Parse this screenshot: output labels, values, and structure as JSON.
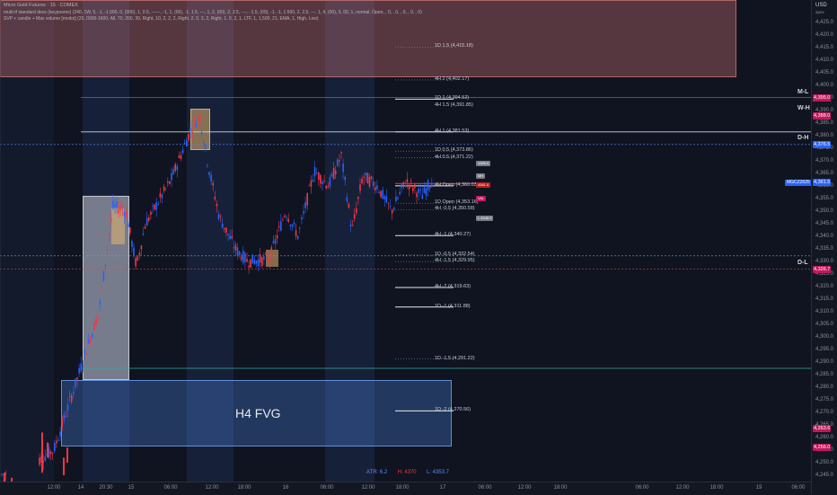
{
  "header": {
    "title": "Micro Gold Futures · 15 · COMEX",
    "indicator1": "multi-tf standard devs (keypoems) (240, 1W, 0, -1, -1.500, 0, (005), 1, 0.5, ------, -1, 1, (00), -1, 1.5, ---, 1, 2, (00), 2, 2.5, ----, -1.5, (00), -1, -1, 1.500, 2, 2.5, ---, 1, 4, (00), 3, 00, 1, normal, Open, , 0, , 0, , 0, , 0, , 0)",
    "indicator2": "SVP + candle + Max volume [mvdot] (20, 0930-1600, All, 70, 200, 30, Right, 10, 2, 2, 2, Right, 2, 0, 3, 2, Right, 1, 0, 2, 1, LTF, 1, 1,500, 21, EMA, 1, High, Low)"
  },
  "currency": "USD",
  "currency_sub": "apex",
  "price_ticks": [
    "4,425.0",
    "4,420.0",
    "4,415.0",
    "4,410.0",
    "4,405.0",
    "4,400.0",
    "4,395.0",
    "4,390.0",
    "4,385.0",
    "4,380.0",
    "4,375.0",
    "4,370.0",
    "4,365.0",
    "4,360.0",
    "4,355.0",
    "4,350.0",
    "4,345.0",
    "4,340.0",
    "4,335.0",
    "4,330.0",
    "4,325.0",
    "4,320.0",
    "4,315.0",
    "4,310.0",
    "4,305.0",
    "4,300.0",
    "4,295.0",
    "4,290.0",
    "4,285.0",
    "4,280.0",
    "4,275.0",
    "4,270.0",
    "4,265.0",
    "4,260.0",
    "4,255.0",
    "4,250.0",
    "4,245.0"
  ],
  "time_ticks": [
    "12:00",
    "14",
    "20:30",
    "15",
    "06:00",
    "12:00",
    "18:00",
    "16",
    "06:00",
    "12:00",
    "18:00",
    "17",
    "06:00",
    "12:00",
    "18:00",
    "06:00",
    "12:00",
    "18:00",
    "19",
    "06:00"
  ],
  "price_tags": [
    {
      "text": "4,395.0",
      "price": 4395.0,
      "color": "#c2185b"
    },
    {
      "text": "4,388.0",
      "price": 4388.0,
      "color": "#c2185b"
    },
    {
      "text": "4,376.5",
      "price": 4376.5,
      "color": "#2962ff"
    },
    {
      "text": "4,361.5",
      "price": 4361.5,
      "color": "#2962ff"
    },
    {
      "text": "4,326.7",
      "price": 4326.7,
      "color": "#c2185b"
    },
    {
      "text": "4,263.6",
      "price": 4263.6,
      "color": "#c2185b"
    },
    {
      "text": "4,256.0",
      "price": 4256.0,
      "color": "#c2185b"
    }
  ],
  "symbol_tag": "MGCZ2025",
  "side_labels": [
    {
      "text": "M-L",
      "price": 4395.5
    },
    {
      "text": "W-H",
      "price": 4389.0
    },
    {
      "text": "D-H",
      "price": 4377.3
    },
    {
      "text": "D-L",
      "price": 4327.5
    }
  ],
  "levels": [
    {
      "label": "1D 1.5 (4,415.18)",
      "price": 4415.18,
      "style": "dotted"
    },
    {
      "label": "4H 2 (4,402.17)",
      "price": 4402.17,
      "style": "dotted"
    },
    {
      "label": "1D 1 (4,394.52)",
      "price": 4394.52,
      "style": "solid"
    },
    {
      "label": "4H 1.5 (4,391.85)",
      "price": 4391.85,
      "style": "none"
    },
    {
      "label": "4H 1 (4,381.53)",
      "price": 4381.53,
      "style": "solid"
    },
    {
      "label": "1D 0.5 (4,373.86)",
      "price": 4373.86,
      "style": "dotted"
    },
    {
      "label": "4H 0.5 (4,371.22)",
      "price": 4371.22,
      "style": "dotted"
    },
    {
      "label": "4H Open (4,360.03)",
      "price": 4360.03,
      "style": "solid"
    },
    {
      "label": "1D Open (4,353.16)",
      "price": 4353.16,
      "style": "dotted"
    },
    {
      "label": "4H -0.5 (4,350.58)",
      "price": 4350.58,
      "style": "dotted"
    },
    {
      "label": "4H -1 (4,340.27)",
      "price": 4340.27,
      "style": "solid"
    },
    {
      "label": "1D -0.5 (4,332.54)",
      "price": 4332.54,
      "style": "dotted"
    },
    {
      "label": "4H -1.5 (4,329.95)",
      "price": 4329.95,
      "style": "dotted"
    },
    {
      "label": "4H -2 (4,319.63)",
      "price": 4319.63,
      "style": "solid"
    },
    {
      "label": "1D -1 (4,311.88)",
      "price": 4311.88,
      "style": "solid"
    },
    {
      "label": "1D -1.5 (4,291.22)",
      "price": 4291.22,
      "style": "dotted"
    },
    {
      "label": "1D -2 (4,270.56)",
      "price": 4270.56,
      "style": "solid"
    }
  ],
  "fvg_label": "H4 FVG",
  "right_pills": [
    {
      "text": "4389.0",
      "price": 4369.0,
      "color": "#787b86"
    },
    {
      "text": "MH",
      "price": 4364.0,
      "color": "#787b86"
    },
    {
      "text": "4361.0",
      "price": 4360.5,
      "color": "#b71c1c"
    },
    {
      "text": "VAL",
      "price": 4355.0,
      "color": "#c2185b"
    },
    {
      "text": "L 4346.0",
      "price": 4347.0,
      "color": "#787b86"
    }
  ],
  "stats": {
    "atr": "ATR: 6.2",
    "high": "H: 4370",
    "low": "L: 4353.7",
    "atr_color": "#5b8cff",
    "high_color": "#f23645",
    "low_color": "#5b8cff"
  },
  "colors": {
    "up": "#2962ff",
    "down": "#f23645",
    "premium_zone": "#f4a0a0",
    "fvg": "#5b9cff"
  }
}
